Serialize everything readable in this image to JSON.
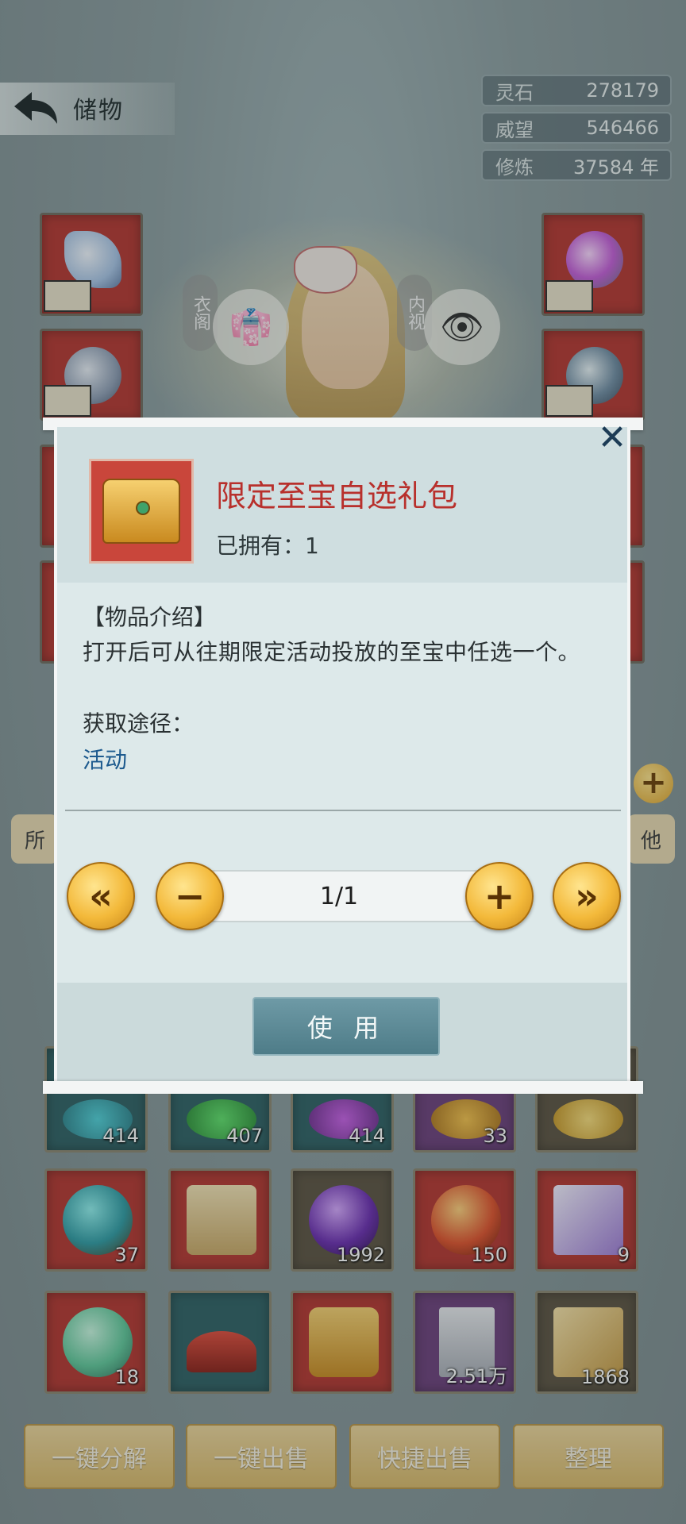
{
  "header": {
    "title": "储物",
    "back_icon": "back-arrow-icon"
  },
  "resources": [
    {
      "label": "灵石",
      "value": "278179"
    },
    {
      "label": "威望",
      "value": "546466"
    },
    {
      "label": "修炼",
      "value": "37584 年"
    }
  ],
  "character_panel": {
    "left_label": "衣阁",
    "right_label": "内视",
    "left_icon": "robe-icon",
    "right_icon": "eye-icon"
  },
  "tabs": {
    "left_partial": "所",
    "right_partial": "他"
  },
  "dialog": {
    "item_name": "限定至宝自选礼包",
    "owned": "已拥有：1",
    "desc_title": "【物品介绍】",
    "desc_text": "打开后可从往期限定活动投放的至宝中任选一个。",
    "acq_title": "获取途径：",
    "acq_link": "活动",
    "stepper_value": "1/1",
    "btn_first": "«",
    "btn_minus": "−",
    "btn_plus": "+",
    "btn_last": "»",
    "use_label": "使 用",
    "close_icon": "close-x-icon"
  },
  "inventory": {
    "row1": [
      {
        "count": "414",
        "bg": "teal"
      },
      {
        "count": "407",
        "bg": "teal"
      },
      {
        "count": "414",
        "bg": "teal"
      },
      {
        "count": "33",
        "bg": "purple"
      },
      {
        "count": "",
        "bg": "brown"
      }
    ],
    "row2": [
      {
        "count": "37",
        "bg": "red"
      },
      {
        "count": "",
        "bg": "red"
      },
      {
        "count": "1992",
        "bg": "brown"
      },
      {
        "count": "150",
        "bg": "red"
      },
      {
        "count": "9",
        "bg": "red"
      }
    ],
    "row3": [
      {
        "count": "18",
        "bg": "red"
      },
      {
        "count": "",
        "bg": "teal"
      },
      {
        "count": "",
        "bg": "red"
      },
      {
        "count": "2.51万",
        "bg": "purple"
      },
      {
        "count": "1868",
        "bg": "brown"
      }
    ]
  },
  "actions": {
    "decompose": "一键分解",
    "sell_all": "一键出售",
    "quick_sell": "快捷出售",
    "arrange": "整理"
  },
  "colors": {
    "item_name": "#b8302c",
    "link": "#1d5a8e",
    "gold_button": "#f3b93a",
    "use_button": "#5a8894"
  }
}
